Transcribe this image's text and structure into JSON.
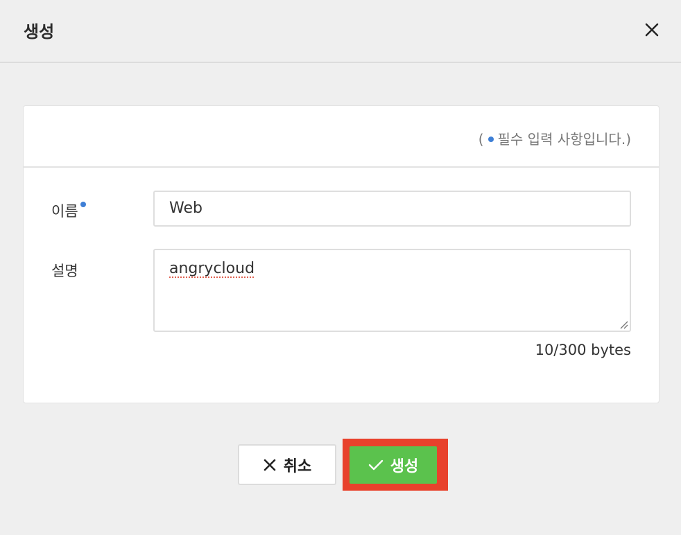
{
  "dialog": {
    "title": "생성",
    "close_icon": "close-icon"
  },
  "form": {
    "required_note_open": "(",
    "required_note_text": "필수 입력 사항입니다.)",
    "name_label": "이름",
    "name_value": "Web",
    "description_label": "설명",
    "description_value": "angrycloud",
    "byte_counter": "10/300 bytes"
  },
  "buttons": {
    "cancel_label": "취소",
    "cancel_icon": "close-icon",
    "create_label": "생성",
    "create_icon": "check-icon"
  },
  "colors": {
    "required_dot": "#3e7fd6",
    "create_button": "#5bc24d",
    "highlight_border": "#e8422c"
  }
}
